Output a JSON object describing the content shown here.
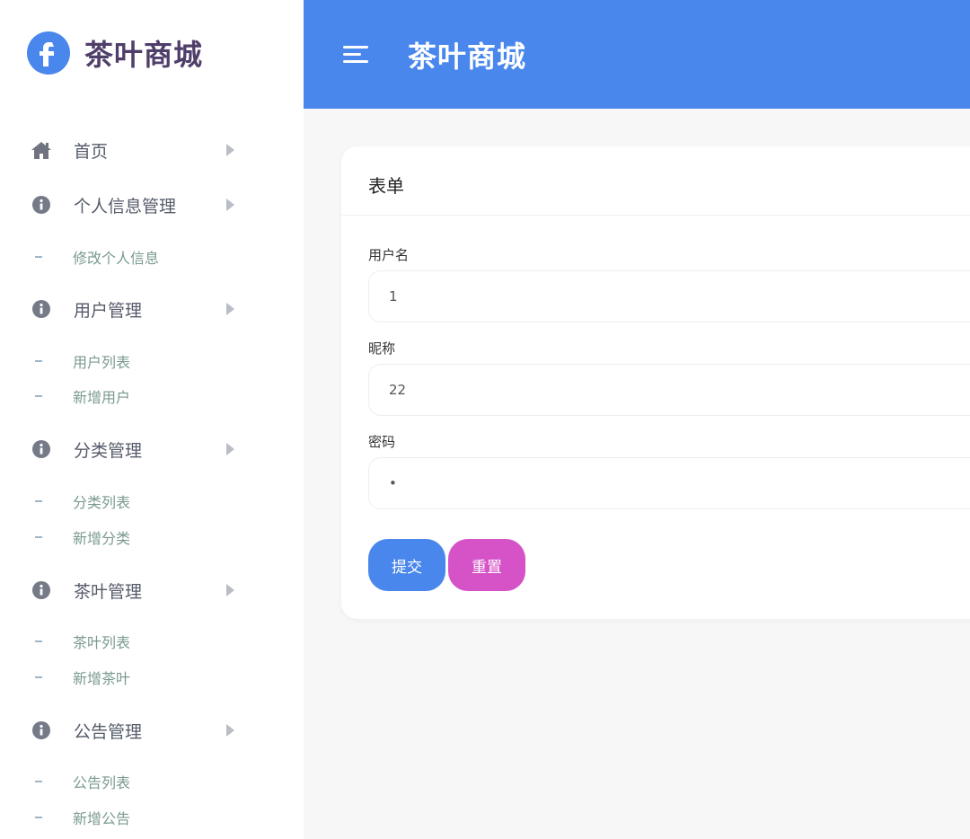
{
  "app": {
    "title": "茶叶商城",
    "logo_letter": "f"
  },
  "header": {
    "title": "茶叶商城"
  },
  "sidebar": {
    "items": [
      {
        "label": "首页",
        "icon": "home-icon",
        "children": []
      },
      {
        "label": "个人信息管理",
        "icon": "info-icon",
        "children": [
          "修改个人信息"
        ]
      },
      {
        "label": "用户管理",
        "icon": "info-icon",
        "children": [
          "用户列表",
          "新增用户"
        ]
      },
      {
        "label": "分类管理",
        "icon": "info-icon",
        "children": [
          "分类列表",
          "新增分类"
        ]
      },
      {
        "label": "茶叶管理",
        "icon": "info-icon",
        "children": [
          "茶叶列表",
          "新增茶叶"
        ]
      },
      {
        "label": "公告管理",
        "icon": "info-icon",
        "children": [
          "公告列表",
          "新增公告"
        ]
      }
    ]
  },
  "form": {
    "title": "表单",
    "fields": [
      {
        "label": "用户名",
        "value": "1"
      },
      {
        "label": "昵称",
        "value": "22"
      },
      {
        "label": "密码",
        "value": "•"
      }
    ],
    "submit_label": "提交",
    "reset_label": "重置"
  },
  "colors": {
    "primary": "#4a87ec",
    "reset": "#d552c7",
    "brand_text": "#4f3e6a",
    "submenu_text": "#7a9a8e"
  }
}
